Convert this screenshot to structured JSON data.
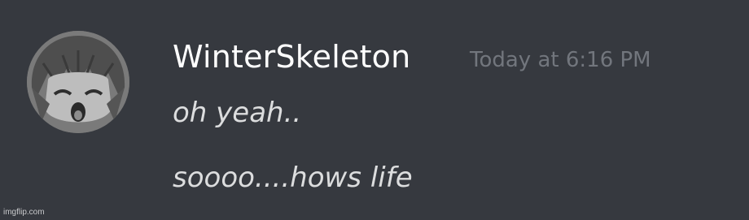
{
  "message": {
    "author": "WinterSkeleton",
    "timestamp": "Today at 6:16 PM",
    "lines": [
      "oh yeah..",
      "soooo....hows life"
    ],
    "avatar_icon": "anime-avatar-icon"
  },
  "watermark": "imgflip.com",
  "colors": {
    "background": "#36393f",
    "username": "#ffffff",
    "timestamp": "#72767d",
    "message_text": "#dcddde"
  }
}
